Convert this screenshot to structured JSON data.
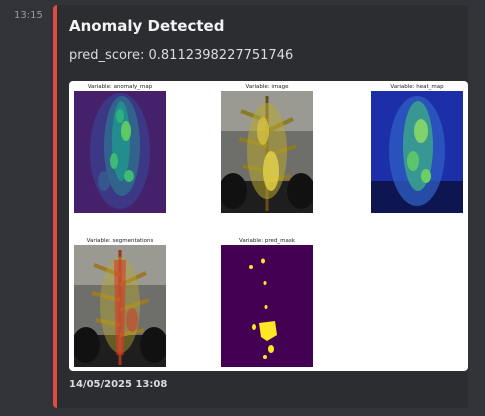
{
  "message": {
    "time": "13:15"
  },
  "embed": {
    "accent_color": "#e04a3f",
    "title": "Anomaly Detected",
    "description": "pred_score: 0.8112398227751746",
    "footer": "14/05/2025 13:08",
    "panels": [
      {
        "label": "Variable: anomaly_map"
      },
      {
        "label": "Variable: image"
      },
      {
        "label": "Variable: heat_map"
      },
      {
        "label": "Variable: segmentations"
      },
      {
        "label": "Variable: pred_mask"
      }
    ]
  }
}
